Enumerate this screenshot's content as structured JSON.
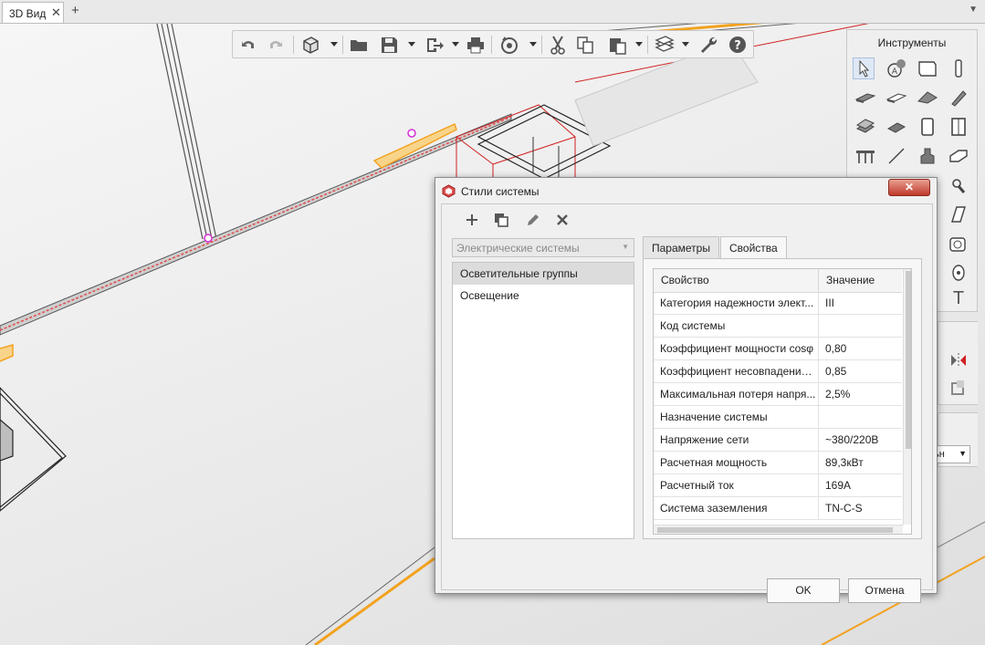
{
  "tabs": {
    "title": "3D Вид",
    "close_glyph": "✕",
    "add_glyph": "+",
    "menu_glyph": "▼"
  },
  "toolbar": {
    "icons": [
      "undo-icon",
      "redo-icon",
      "3d-box-icon",
      "open-folder-icon",
      "save-icon",
      "export-icon",
      "print-icon",
      "sync-cloud-icon",
      "cut-icon",
      "copy-icon",
      "paste-icon",
      "layers-icon",
      "wrench-icon",
      "help-icon"
    ]
  },
  "tools_panel": {
    "title": "Инструменты",
    "text_tool_glyph": "T"
  },
  "side_combo": {
    "fragment": "ьн"
  },
  "dialog": {
    "title": "Стили системы",
    "close_glyph": "✕",
    "system_select": "Электрические системы",
    "select_arrow": "▼",
    "groups": [
      "Осветительные группы",
      "Освещение"
    ],
    "tabs": [
      "Параметры",
      "Свойства"
    ],
    "grid": {
      "headers": [
        "Свойство",
        "Значение"
      ],
      "rows": [
        {
          "name": "Категория надежности элект...",
          "value": "III"
        },
        {
          "name": "Код системы",
          "value": ""
        },
        {
          "name": "Коэффициент мощности cosφ",
          "value": "0,80"
        },
        {
          "name": "Коэффициент несовпадения ...",
          "value": "0,85"
        },
        {
          "name": "Максимальная потеря напря...",
          "value": "2,5%"
        },
        {
          "name": "Назначение системы",
          "value": ""
        },
        {
          "name": "Напряжение сети",
          "value": "~380/220В"
        },
        {
          "name": "Расчетная мощность",
          "value": "89,3кВт"
        },
        {
          "name": "Расчетный ток",
          "value": "169А"
        },
        {
          "name": "Система заземления",
          "value": "TN-C-S"
        }
      ]
    },
    "ok_label": "OK",
    "cancel_label": "Отмена"
  },
  "colors": {
    "accent_close": "#c0392b",
    "cable_orange": "#f2a21e",
    "wire_red": "#d02020",
    "node_magenta": "#d62fd6"
  }
}
